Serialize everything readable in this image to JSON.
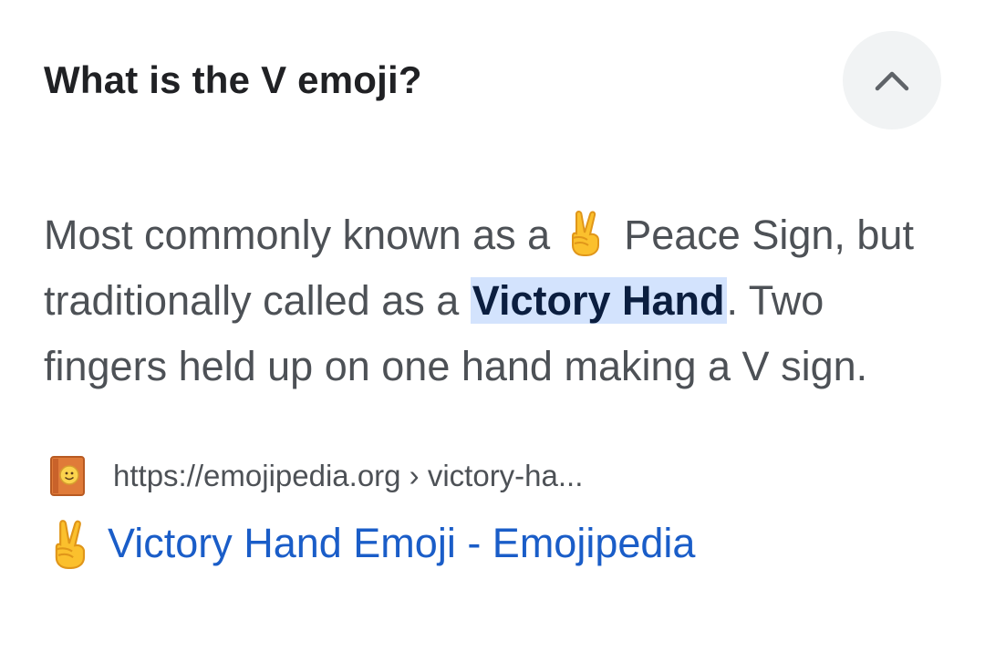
{
  "question": "What is the V emoji?",
  "collapse_icon": "chevron-up-icon",
  "answer": {
    "part1": "Most commonly known as a ",
    "emoji_icon": "victory-hand-emoji-icon",
    "part2": " Peace Sign, but traditionally called as a ",
    "highlight": "Victory Hand",
    "part3": ". Two fingers held up on one hand making a V sign."
  },
  "source": {
    "favicon": "emojipedia-favicon-icon",
    "url": "https://emojipedia.org › victory-ha..."
  },
  "result": {
    "emoji_icon": "victory-hand-emoji-icon",
    "title": "Victory Hand Emoji - Emojipedia"
  },
  "colors": {
    "highlight_bg": "#d3e3fd",
    "link": "#1a5dc8",
    "body_text": "#4d5156",
    "heading": "#202124"
  }
}
